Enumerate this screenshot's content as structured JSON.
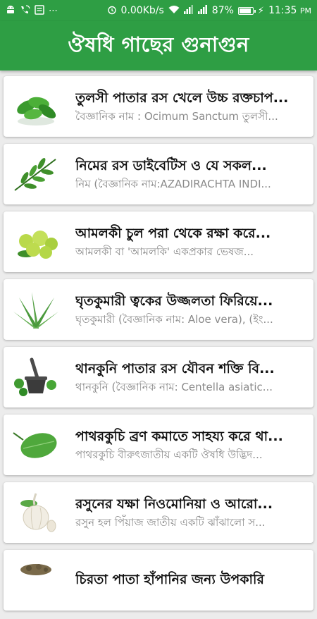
{
  "status_bar": {
    "network_speed": "0.00Kb/s",
    "battery_percent": "87%",
    "battery_level": 0.87,
    "time": "11:35",
    "ampm": "PM",
    "icons": [
      "android-icon",
      "phone-wifi-icon",
      "message-icon",
      "more-dots-icon",
      "alarm-icon",
      "wifi-icon",
      "signal-icon",
      "signal-icon",
      "battery-icon",
      "charging-icon"
    ]
  },
  "app_bar": {
    "title": "ঔষধি গাছের গুনাগুন"
  },
  "items": [
    {
      "title": "তুলসী পাতার রস খেলে উচ্চ রক্তচাপ...",
      "desc": "বৈজ্ঞানিক নাম : Ocimum Sanctum তুলসী...",
      "image": "tulsi-leaves-image"
    },
    {
      "title": "নিমের রস ডাইবেটিস ও যে সকল...",
      "desc": "নিম (বৈজ্ঞানিক নাম:AZADIRACHTA INDI...",
      "image": "neem-leaves-image"
    },
    {
      "title": "আমলকী চুল পরা থেকে রক্ষা করে...",
      "desc": "আমলকী বা 'আমলকি' একপ্রকার ভেষজ...",
      "image": "amla-fruit-image"
    },
    {
      "title": "ঘৃতকুমারী ত্বকের উজ্জলতা ফিরিয়ে...",
      "desc": "ঘৃতকুমারী (বৈজ্ঞানিক নাম: Aloe vera), (ইং...",
      "image": "aloe-vera-image"
    },
    {
      "title": "থানকুনি পাতার রস যৌবন শক্তি বি...",
      "desc": "থানকুনি (বৈজ্ঞানিক নাম: Centella asiatic...",
      "image": "thankuni-mortar-image"
    },
    {
      "title": "পাথরকুচি ব্রণ কমাতে সাহয্য করে থা...",
      "desc": "পাথরকুচি বীরুৎজাতীয় একটি ঔষধি উদ্ভিদ...",
      "image": "pathorkuchi-leaf-image"
    },
    {
      "title": "রসুনের যক্ষা নিওমোনিয়া ও আরো...",
      "desc": "রসুন হল পিঁয়াজ জাতীয় একটি ঝাঁঝালো স...",
      "image": "garlic-image"
    },
    {
      "title": "চিরতা পাতা হাঁপানির জন্য উপকারি",
      "desc": "",
      "image": "chirota-image"
    }
  ]
}
